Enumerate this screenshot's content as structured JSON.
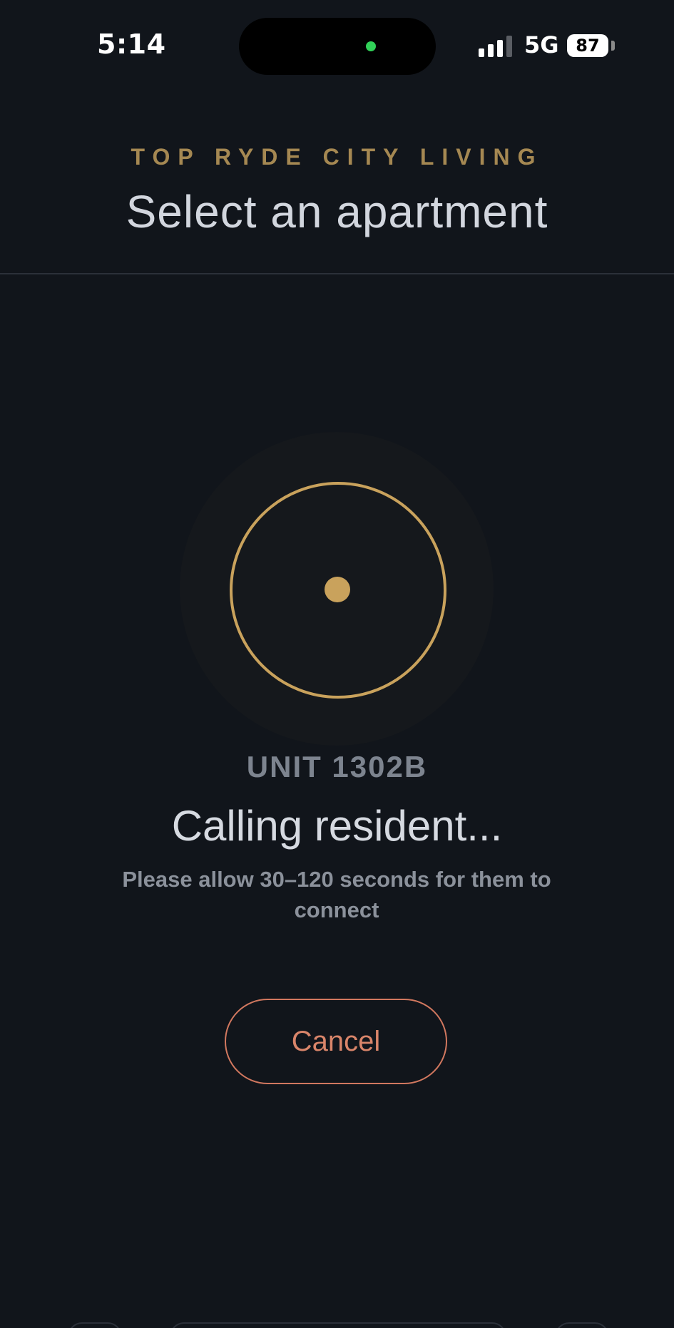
{
  "status_bar": {
    "time": "5:14",
    "network": "5G",
    "battery_level": "87",
    "signal_bars_active": 3,
    "signal_bars_total": 4,
    "privacy_indicator_color": "#31d158"
  },
  "header": {
    "building_name": "TOP RYDE CITY LIVING",
    "title": "Select an apartment"
  },
  "call": {
    "unit": "UNIT 1302B",
    "status": "Calling resident...",
    "note": "Please allow 30–120 seconds for them to connect",
    "cancel_label": "Cancel"
  },
  "colors": {
    "background": "#11151b",
    "accent_gold": "#c9a25c",
    "cancel_accent": "#d2785f"
  },
  "icons": {
    "call_indicator": "pulsing-ring-icon",
    "signal": "cellular-signal-icon",
    "battery": "battery-icon"
  }
}
